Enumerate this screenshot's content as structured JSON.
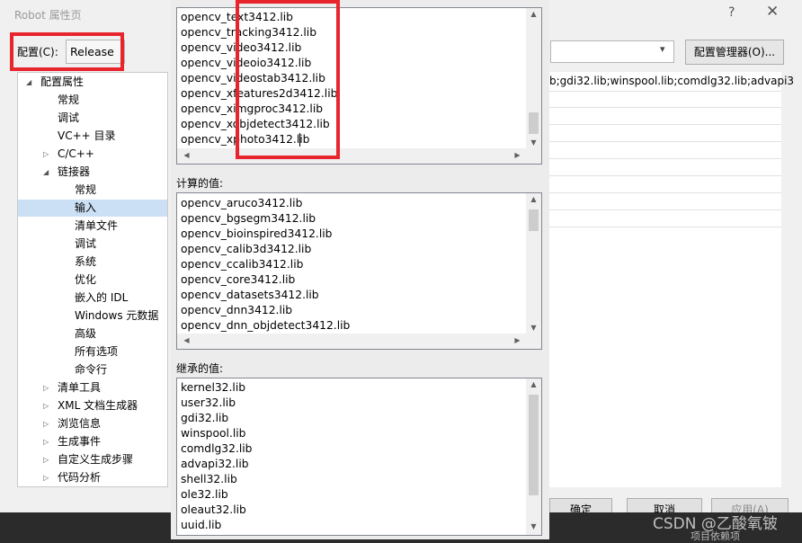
{
  "window": {
    "title": "Robot 属性页",
    "help_glyph": "?",
    "close_glyph": "✕",
    "config_label": "配置(C):",
    "config_value": "Release",
    "config_manager_label": "配置管理器(O)...",
    "dependencies_value": "b;gdi32.lib;winspool.lib;comdlg32.lib;advapi3",
    "ok_label": "确定",
    "cancel_label": "取消",
    "apply_label": "应用(A)",
    "partial_label": "项目依赖项"
  },
  "tree": [
    {
      "label": "配置属性",
      "level": 0,
      "arrow": "expanded"
    },
    {
      "label": "常规",
      "level": 1
    },
    {
      "label": "调试",
      "level": 1
    },
    {
      "label": "VC++ 目录",
      "level": 1
    },
    {
      "label": "C/C++",
      "level": 1,
      "arrow": "collapsed"
    },
    {
      "label": "链接器",
      "level": 1,
      "arrow": "expanded"
    },
    {
      "label": "常规",
      "level": 2
    },
    {
      "label": "输入",
      "level": 2,
      "selected": true
    },
    {
      "label": "清单文件",
      "level": 2
    },
    {
      "label": "调试",
      "level": 2
    },
    {
      "label": "系统",
      "level": 2
    },
    {
      "label": "优化",
      "level": 2
    },
    {
      "label": "嵌入的 IDL",
      "level": 2
    },
    {
      "label": "Windows 元数据",
      "level": 2
    },
    {
      "label": "高级",
      "level": 2
    },
    {
      "label": "所有选项",
      "level": 2
    },
    {
      "label": "命令行",
      "level": 2
    },
    {
      "label": "清单工具",
      "level": 1,
      "arrow": "collapsed"
    },
    {
      "label": "XML 文档生成器",
      "level": 1,
      "arrow": "collapsed"
    },
    {
      "label": "浏览信息",
      "level": 1,
      "arrow": "collapsed"
    },
    {
      "label": "生成事件",
      "level": 1,
      "arrow": "collapsed"
    },
    {
      "label": "自定义生成步骤",
      "level": 1,
      "arrow": "collapsed"
    },
    {
      "label": "代码分析",
      "level": 1,
      "arrow": "collapsed"
    }
  ],
  "dialog": {
    "edit_lines": [
      "opencv_text3412.lib",
      "opencv_tracking3412.lib",
      "opencv_video3412.lib",
      "opencv_videoio3412.lib",
      "opencv_videostab3412.lib",
      "opencv_xfeatures2d3412.lib",
      "opencv_ximgproc3412.lib",
      "opencv_xobjdetect3412.lib",
      "opencv_xphoto3412.lib"
    ],
    "computed_label": "计算的值:",
    "computed_lines": [
      "opencv_aruco3412.lib",
      "opencv_bgsegm3412.lib",
      "opencv_bioinspired3412.lib",
      "opencv_calib3d3412.lib",
      "opencv_ccalib3412.lib",
      "opencv_core3412.lib",
      "opencv_datasets3412.lib",
      "opencv_dnn3412.lib",
      "opencv_dnn_objdetect3412.lib"
    ],
    "inherited_label": "继承的值:",
    "inherited_lines": [
      "kernel32.lib",
      "user32.lib",
      "gdi32.lib",
      "winspool.lib",
      "comdlg32.lib",
      "advapi32.lib",
      "shell32.lib",
      "ole32.lib",
      "oleaut32.lib",
      "uuid.lib"
    ]
  },
  "watermark": "CSDN @乙酸氧铍",
  "colors": {
    "highlight": "#e8242c",
    "selection": "#cce0f5"
  }
}
